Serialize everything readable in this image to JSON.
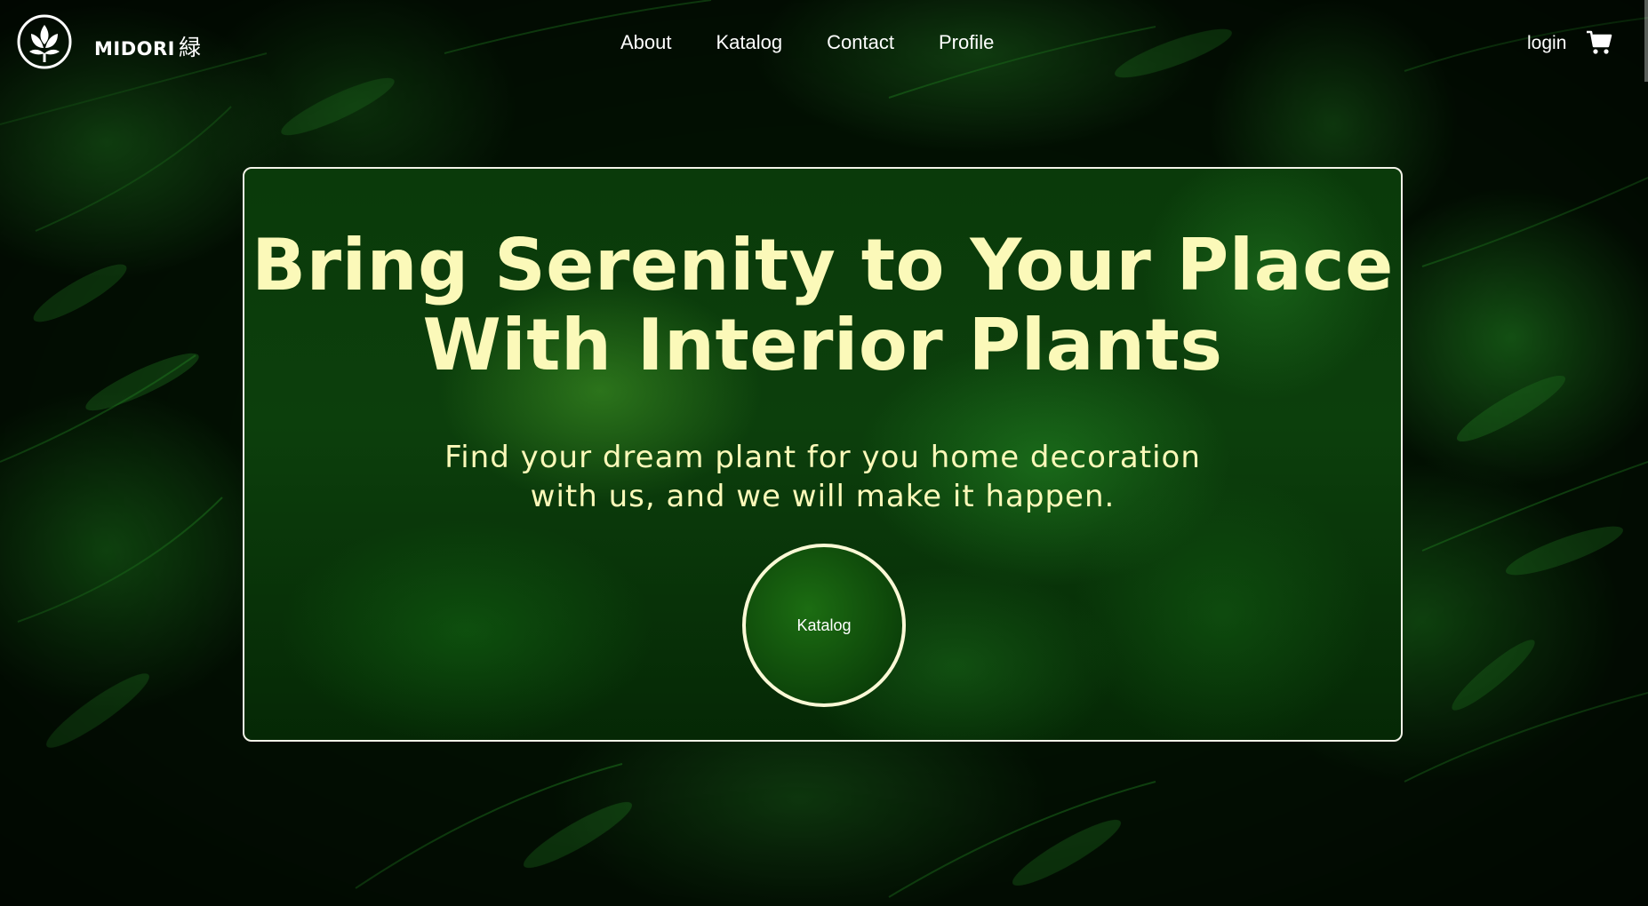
{
  "brand": {
    "name": "MIDORI",
    "kanji": "緑",
    "logo_icon": "plant-leaf-logo-icon"
  },
  "nav": {
    "links": [
      {
        "label": "About"
      },
      {
        "label": "Katalog"
      },
      {
        "label": "Contact"
      },
      {
        "label": "Profile"
      }
    ],
    "login_label": "login",
    "cart_icon": "shopping-cart-icon"
  },
  "hero": {
    "title_line1": "Bring Serenity to Your Place",
    "title_line2": "With Interior Plants",
    "subtitle_line1": "Find your dream plant for you home decoration",
    "subtitle_line2": "with us, and we will make it happen.",
    "cta_label": "Katalog"
  },
  "colors": {
    "accent_text": "#fbf9b9",
    "nav_text": "#ffffff",
    "card_border": "#f3f3e8",
    "background": "#031103"
  }
}
